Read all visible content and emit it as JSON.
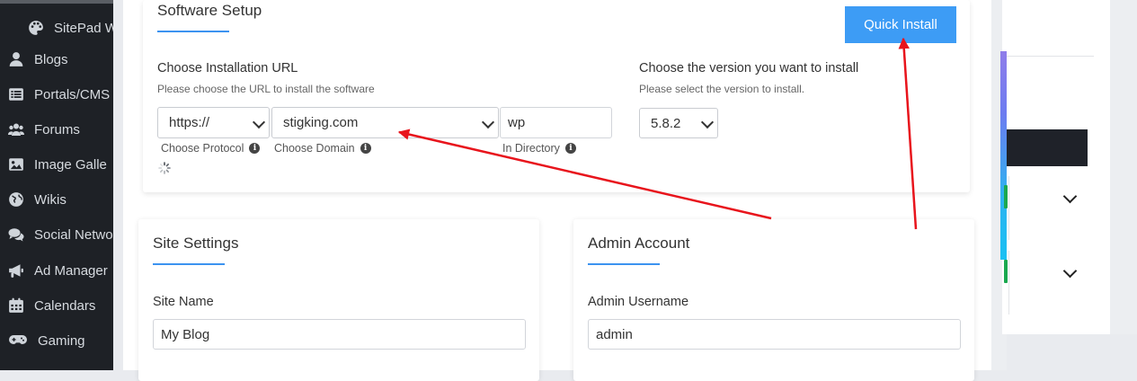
{
  "sidebar": {
    "items": [
      {
        "label": "SitePad W",
        "icon": "palette-icon"
      },
      {
        "label": "Blogs",
        "icon": "user-icon"
      },
      {
        "label": "Portals/CMS",
        "icon": "list-icon"
      },
      {
        "label": "Forums",
        "icon": "users-icon"
      },
      {
        "label": "Image Galle",
        "icon": "image-icon"
      },
      {
        "label": "Wikis",
        "icon": "globe-icon"
      },
      {
        "label": "Social Netwo",
        "icon": "comments-icon"
      },
      {
        "label": "Ad Manager",
        "icon": "bullhorn-icon"
      },
      {
        "label": "Calendars",
        "icon": "calendar-icon"
      },
      {
        "label": "Gaming",
        "icon": "gamepad-icon"
      }
    ]
  },
  "setup": {
    "title": "Software Setup",
    "quick_install": "Quick Install",
    "url_label": "Choose Installation URL",
    "url_help": "Please choose the URL to install the software",
    "protocol_value": "https://",
    "domain_value": "stigking.com",
    "directory_value": "wp",
    "protocol_label": "Choose Protocol",
    "domain_label": "Choose Domain",
    "directory_label": "In Directory",
    "version_label": "Choose the version you want to install",
    "version_help": "Please select the version to install.",
    "version_value": "5.8.2"
  },
  "site_settings": {
    "title": "Site Settings",
    "site_name_label": "Site Name",
    "site_name_value": "My Blog"
  },
  "admin_account": {
    "title": "Admin Account",
    "username_label": "Admin Username",
    "username_value": "admin"
  },
  "colors": {
    "accent": "#3d9cf5",
    "sidebar_bg": "#1e2126",
    "arrow": "#e8141c"
  }
}
